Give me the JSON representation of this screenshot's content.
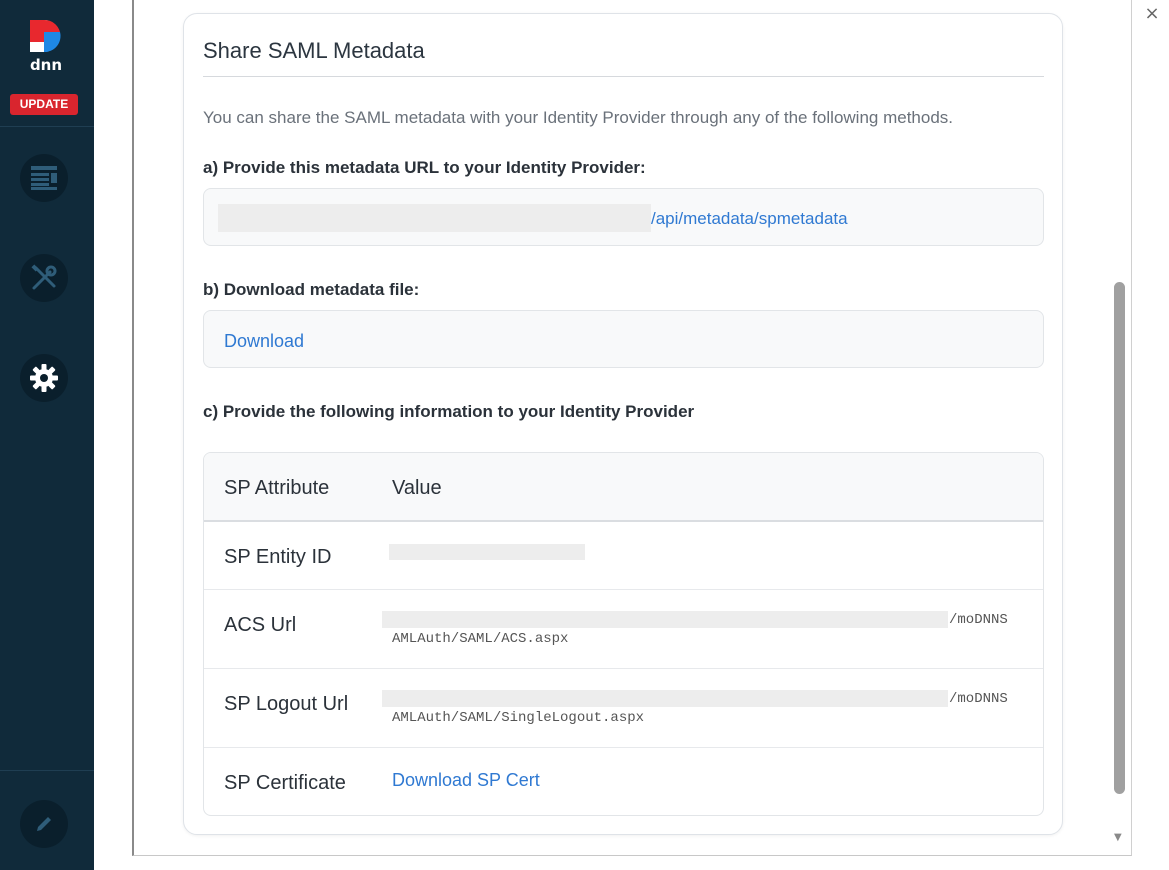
{
  "sidebar": {
    "logo_text": "dnn",
    "update_label": "UPDATE",
    "icons": [
      "content-icon",
      "tools-icon",
      "settings-icon",
      "edit-icon"
    ]
  },
  "modal": {
    "close_label": "×"
  },
  "card": {
    "title": "Share SAML Metadata",
    "intro": "You can share the SAML metadata with your Identity Provider through any of the following methods.",
    "section_a_label": "a) Provide this metadata URL to your Identity Provider:",
    "metadata_url_suffix": "/api/metadata/spmetadata",
    "section_b_label": "b) Download metadata file:",
    "download_label": "Download",
    "section_c_label": "c) Provide the following information to your Identity Provider"
  },
  "table": {
    "headers": [
      "SP Attribute",
      "Value"
    ],
    "rows": [
      {
        "attribute": "SP Entity ID",
        "value_line1": "",
        "value_line2": ""
      },
      {
        "attribute": "ACS Url",
        "value_line1": "/moDNNS",
        "value_line2": "AMLAuth/SAML/ACS.aspx"
      },
      {
        "attribute": "SP Logout Url",
        "value_line1": "/moDNNS",
        "value_line2": "AMLAuth/SAML/SingleLogout.aspx"
      },
      {
        "attribute": "SP Certificate",
        "link": "Download SP Cert"
      }
    ]
  },
  "colors": {
    "sidebar_bg": "#102a3a",
    "update_red": "#d9252e",
    "link_blue": "#2f79d2"
  }
}
